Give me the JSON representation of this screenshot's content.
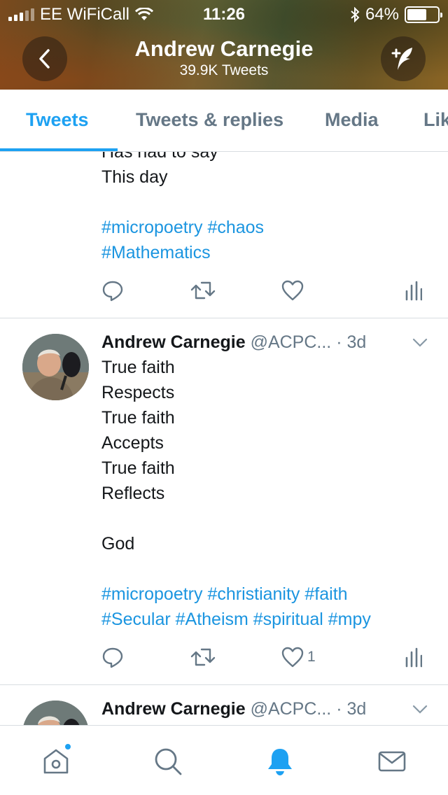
{
  "status_bar": {
    "carrier": "EE WiFiCall",
    "time": "11:26",
    "battery": "64%",
    "battery_level": 0.64
  },
  "header": {
    "name": "Andrew Carnegie",
    "tweet_count": "39.9K Tweets",
    "back_icon": "chevron-left-icon",
    "compose_icon": "compose-tweet-icon"
  },
  "tabs": [
    {
      "label": "Tweets",
      "active": true
    },
    {
      "label": "Tweets & replies",
      "active": false
    },
    {
      "label": "Media",
      "active": false
    },
    {
      "label": "Lik",
      "active": false
    }
  ],
  "tweets": [
    {
      "lines": [
        "Has had to say",
        "This day"
      ],
      "hashtags": [
        "#micropoetry #chaos",
        "#Mathematics"
      ],
      "likes": ""
    },
    {
      "name": "Andrew Carnegie",
      "handle": "@ACPC...",
      "time": "· 3d",
      "lines": [
        "True faith",
        "Respects",
        "True faith",
        "Accepts",
        "True faith",
        "Reflects",
        "",
        "God"
      ],
      "hashtags": [
        "#micropoetry #christianity #faith",
        "#Secular #Atheism #spiritual #mpy"
      ],
      "likes": "1"
    },
    {
      "name": "Andrew Carnegie",
      "handle": "@ACPC...",
      "time": "· 3d"
    }
  ],
  "tab_bar": [
    {
      "icon": "home-icon",
      "has_badge": true
    },
    {
      "icon": "search-icon",
      "has_badge": false
    },
    {
      "icon": "notifications-bell-icon",
      "active": true
    },
    {
      "icon": "messages-envelope-icon",
      "has_badge": false
    }
  ],
  "colors": {
    "accent": "#1da1f2",
    "hashtag": "#1b95e0",
    "muted": "#657786",
    "divider": "#d8dde1"
  }
}
